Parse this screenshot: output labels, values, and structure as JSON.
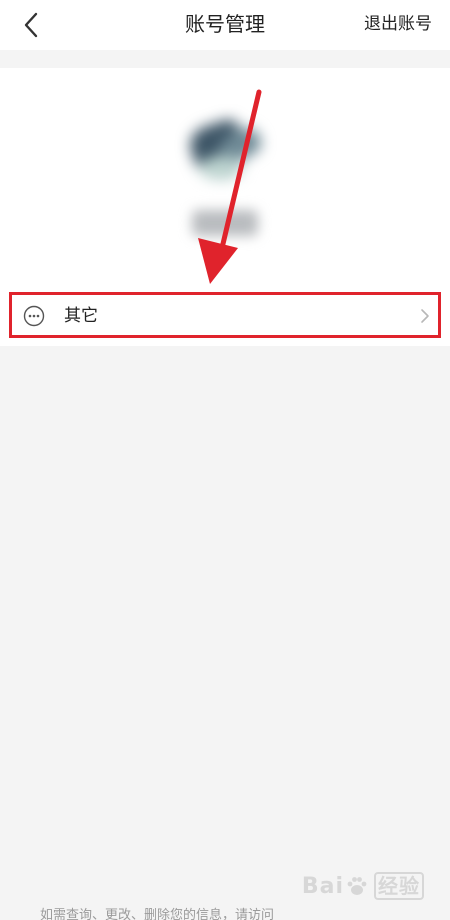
{
  "header": {
    "title": "账号管理",
    "logout_label": "退出账号"
  },
  "account": {
    "menu_item_other": "其它"
  },
  "footer": {
    "hint": "如需查询、更改、删除您的信息，请访问"
  },
  "watermark": {
    "text_prefix": "Bai",
    "text_suffix": "经验"
  },
  "colors": {
    "highlight": "#e0232c",
    "background": "#f4f4f4"
  },
  "icons": {
    "back": "chevron-left-icon",
    "other": "more-dots-circle-icon",
    "row_arrow": "chevron-right-icon"
  }
}
